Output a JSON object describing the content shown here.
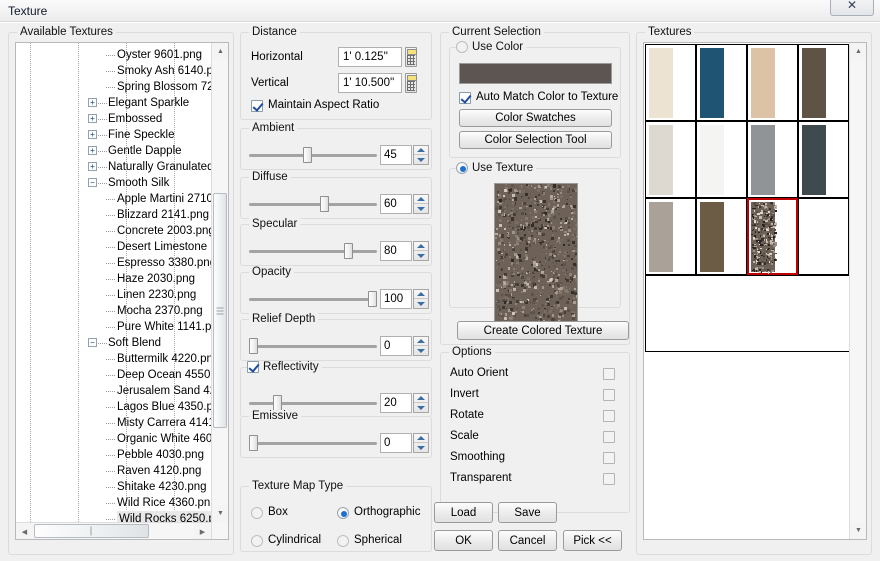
{
  "window": {
    "title": "Texture",
    "close_label": "✕",
    "close_icon": "close-icon"
  },
  "available": {
    "caption": "Available Textures",
    "tree": [
      {
        "label": "Oyster 9601.png",
        "depth": 3,
        "type": "leaf"
      },
      {
        "label": "Smoky Ash 6140.p",
        "depth": 3,
        "type": "leaf"
      },
      {
        "label": "Spring Blossom 72(",
        "depth": 3,
        "type": "leaf"
      },
      {
        "label": "Elegant Sparkle",
        "depth": 2,
        "type": "collapsed"
      },
      {
        "label": "Embossed",
        "depth": 2,
        "type": "collapsed"
      },
      {
        "label": "Fine Speckle",
        "depth": 2,
        "type": "collapsed"
      },
      {
        "label": "Gentle Dapple",
        "depth": 2,
        "type": "collapsed"
      },
      {
        "label": "Naturally Granulated",
        "depth": 2,
        "type": "collapsed"
      },
      {
        "label": "Smooth Silk",
        "depth": 2,
        "type": "expanded"
      },
      {
        "label": "Apple Martini 2710",
        "depth": 3,
        "type": "leaf"
      },
      {
        "label": "Blizzard 2141.png",
        "depth": 3,
        "type": "leaf"
      },
      {
        "label": "Concrete 2003.png",
        "depth": 3,
        "type": "leaf"
      },
      {
        "label": "Desert Limestone 2",
        "depth": 3,
        "type": "leaf"
      },
      {
        "label": "Espresso 3380.png",
        "depth": 3,
        "type": "leaf"
      },
      {
        "label": "Haze 2030.png",
        "depth": 3,
        "type": "leaf"
      },
      {
        "label": "Linen 2230.png",
        "depth": 3,
        "type": "leaf"
      },
      {
        "label": "Mocha 2370.png",
        "depth": 3,
        "type": "leaf"
      },
      {
        "label": "Pure White 1141.p",
        "depth": 3,
        "type": "leaf"
      },
      {
        "label": "Soft Blend",
        "depth": 2,
        "type": "expanded"
      },
      {
        "label": "Buttermilk 4220.pn",
        "depth": 3,
        "type": "leaf"
      },
      {
        "label": "Deep Ocean 4550",
        "depth": 3,
        "type": "leaf"
      },
      {
        "label": "Jerusalem Sand 42",
        "depth": 3,
        "type": "leaf"
      },
      {
        "label": "Lagos Blue 4350.p",
        "depth": 3,
        "type": "leaf"
      },
      {
        "label": "Misty Carrera 4141",
        "depth": 3,
        "type": "leaf"
      },
      {
        "label": "Organic White 460",
        "depth": 3,
        "type": "leaf"
      },
      {
        "label": "Pebble 4030.png",
        "depth": 3,
        "type": "leaf"
      },
      {
        "label": "Raven 4120.png",
        "depth": 3,
        "type": "leaf"
      },
      {
        "label": "Shitake 4230.png",
        "depth": 3,
        "type": "leaf"
      },
      {
        "label": "Wild Rice 4360.pn",
        "depth": 3,
        "type": "leaf"
      },
      {
        "label": "Wild Rocks 6250.p",
        "depth": 3,
        "type": "leaf",
        "selected": true
      }
    ]
  },
  "distance": {
    "caption": "Distance",
    "horizontal_label": "Horizontal",
    "horizontal_value": "1' 0.125''",
    "vertical_label": "Vertical",
    "vertical_value": "1' 10.500''",
    "maintain_label": "Maintain Aspect Ratio",
    "maintain_checked": true,
    "calculator_icon": "calculator-icon"
  },
  "sliders": [
    {
      "caption": "Ambient",
      "value": "45",
      "percent": 45,
      "has_checkbox": false
    },
    {
      "caption": "Diffuse",
      "value": "60",
      "percent": 60,
      "has_checkbox": false
    },
    {
      "caption": "Specular",
      "value": "80",
      "percent": 80,
      "has_checkbox": false
    },
    {
      "caption": "Opacity",
      "value": "100",
      "percent": 100,
      "has_checkbox": false
    },
    {
      "caption": "Relief Depth",
      "value": "0",
      "percent": 0,
      "has_checkbox": false
    },
    {
      "caption": "Reflectivity",
      "value": "20",
      "percent": 20,
      "has_checkbox": true,
      "checked": true
    },
    {
      "caption": "Emissive",
      "value": "0",
      "percent": 0,
      "has_checkbox": false
    }
  ],
  "map_type": {
    "caption": "Texture Map Type",
    "options": [
      {
        "label": "Box",
        "selected": false
      },
      {
        "label": "Orthographic",
        "selected": true
      },
      {
        "label": "Cylindrical",
        "selected": false
      },
      {
        "label": "Spherical",
        "selected": false
      }
    ]
  },
  "current_selection": {
    "caption": "Current Selection",
    "use_color_label": "Use Color",
    "use_color_selected": false,
    "color_value": "#5d5552",
    "auto_match_label": "Auto Match Color to Texture",
    "auto_match_checked": true,
    "color_swatches_label": "Color Swatches",
    "color_selection_tool_label": "Color Selection Tool",
    "use_texture_label": "Use Texture",
    "use_texture_selected": true,
    "create_colored_texture_label": "Create Colored Texture",
    "preview_base_color": "#6d6158"
  },
  "options": {
    "caption": "Options",
    "items": [
      {
        "label": "Auto Orient",
        "checked": false
      },
      {
        "label": "Invert",
        "checked": false
      },
      {
        "label": "Rotate",
        "checked": false
      },
      {
        "label": "Scale",
        "checked": false
      },
      {
        "label": "Smoothing",
        "checked": false
      },
      {
        "label": "Transparent",
        "checked": false
      }
    ]
  },
  "buttons": {
    "load": "Load",
    "save": "Save",
    "ok": "OK",
    "cancel": "Cancel",
    "pick": "Pick <<"
  },
  "textures_panel": {
    "caption": "Textures",
    "selected_index": 10,
    "swatches": [
      {
        "color": "#ece3d2"
      },
      {
        "color": "#1f5572"
      },
      {
        "color": "#dcc3a5"
      },
      {
        "color": "#5e5344"
      },
      {
        "color": "#ddd8d0"
      },
      {
        "color": "#f4f4f2"
      },
      {
        "color": "#919496"
      },
      {
        "color": "#3e4a4e"
      },
      {
        "color": "#aaa299"
      },
      {
        "color": "#6d5c45"
      },
      {
        "color": "#6d6158"
      }
    ]
  }
}
